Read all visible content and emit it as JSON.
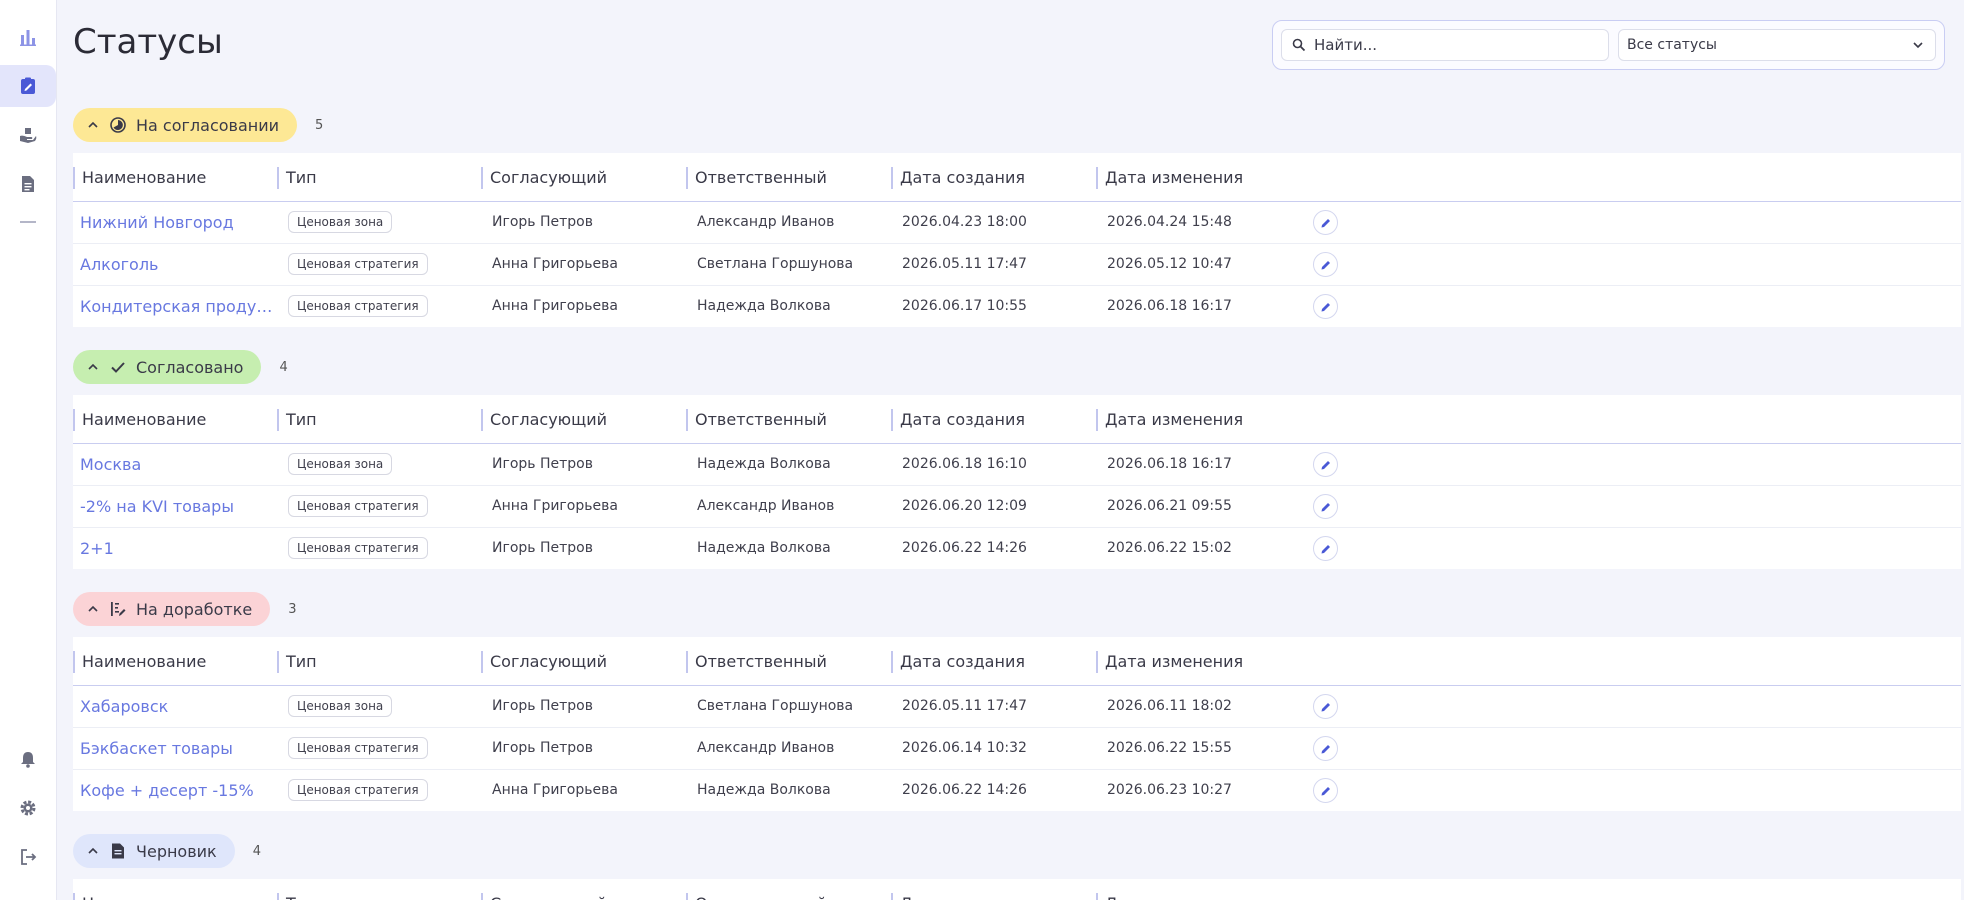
{
  "page": {
    "title": "Статусы"
  },
  "search": {
    "placeholder": "Найти..."
  },
  "filter": {
    "selected": "Все статусы"
  },
  "sidebar": {
    "items": [
      {
        "name": "analytics",
        "icon": "bar-chart-icon"
      },
      {
        "name": "statuses",
        "icon": "clipboard-edit-icon",
        "active": true
      },
      {
        "name": "hand-box",
        "icon": "hand-box-icon"
      },
      {
        "name": "documents",
        "icon": "document-icon"
      }
    ],
    "bottom": [
      {
        "name": "notifications",
        "icon": "bell-icon"
      },
      {
        "name": "settings",
        "icon": "gear-icon"
      },
      {
        "name": "logout",
        "icon": "logout-icon"
      }
    ]
  },
  "colors": {
    "accent": "#6878e0",
    "pending": "#fde895",
    "approved": "#c6eeb0",
    "revision": "#fbd3d6",
    "draft": "#dfe6fb"
  },
  "columns": [
    "Наименование",
    "Тип",
    "Согласующий",
    "Ответственный",
    "Дата создания",
    "Дата изменения"
  ],
  "groups": [
    {
      "label": "На согласовании",
      "count": "5",
      "icon": "clock-half-icon",
      "rows": [
        [
          "Нижний Новгород",
          "Ценовая зона",
          "Игорь Петров",
          "Александр Иванов",
          "2026.04.23 18:00",
          "2026.04.24 15:48"
        ],
        [
          "Алкоголь",
          "Ценовая стратегия",
          "Анна Григорьева",
          "Светлана Горшунова",
          "2026.05.11 17:47",
          "2026.05.12 10:47"
        ],
        [
          "Кондитерская продукция",
          "Ценовая стратегия",
          "Анна Григорьева",
          "Надежда Волкова",
          "2026.06.17 10:55",
          "2026.06.18 16:17"
        ]
      ]
    },
    {
      "label": "Согласовано",
      "count": "4",
      "icon": "check-icon",
      "rows": [
        [
          "Москва",
          "Ценовая зона",
          "Игорь Петров",
          "Надежда Волкова",
          "2026.06.18 16:10",
          "2026.06.18 16:17"
        ],
        [
          "-2% на KVI товары",
          "Ценовая стратегия",
          "Анна Григорьева",
          "Александр Иванов",
          "2026.06.20 12:09",
          "2026.06.21 09:55"
        ],
        [
          "2+1",
          "Ценовая стратегия",
          "Игорь Петров",
          "Надежда Волкова",
          "2026.06.22 14:26",
          "2026.06.22 15:02"
        ]
      ]
    },
    {
      "label": "На доработке",
      "count": "3",
      "icon": "list-edit-icon",
      "rows": [
        [
          "Хабаровск",
          "Ценовая зона",
          "Игорь Петров",
          "Светлана Горшунова",
          "2026.05.11 17:47",
          "2026.06.11 18:02"
        ],
        [
          "Бэкбаскет товары",
          "Ценовая стратегия",
          "Игорь Петров",
          "Александр Иванов",
          "2026.06.14 10:32",
          "2026.06.22 15:55"
        ],
        [
          "Кофе + десерт -15%",
          "Ценовая стратегия",
          "Анна Григорьева",
          "Надежда Волкова",
          "2026.06.22 14:26",
          "2026.06.23 10:27"
        ]
      ]
    },
    {
      "label": "Черновик",
      "count": "4",
      "icon": "file-icon",
      "rows": []
    }
  ]
}
